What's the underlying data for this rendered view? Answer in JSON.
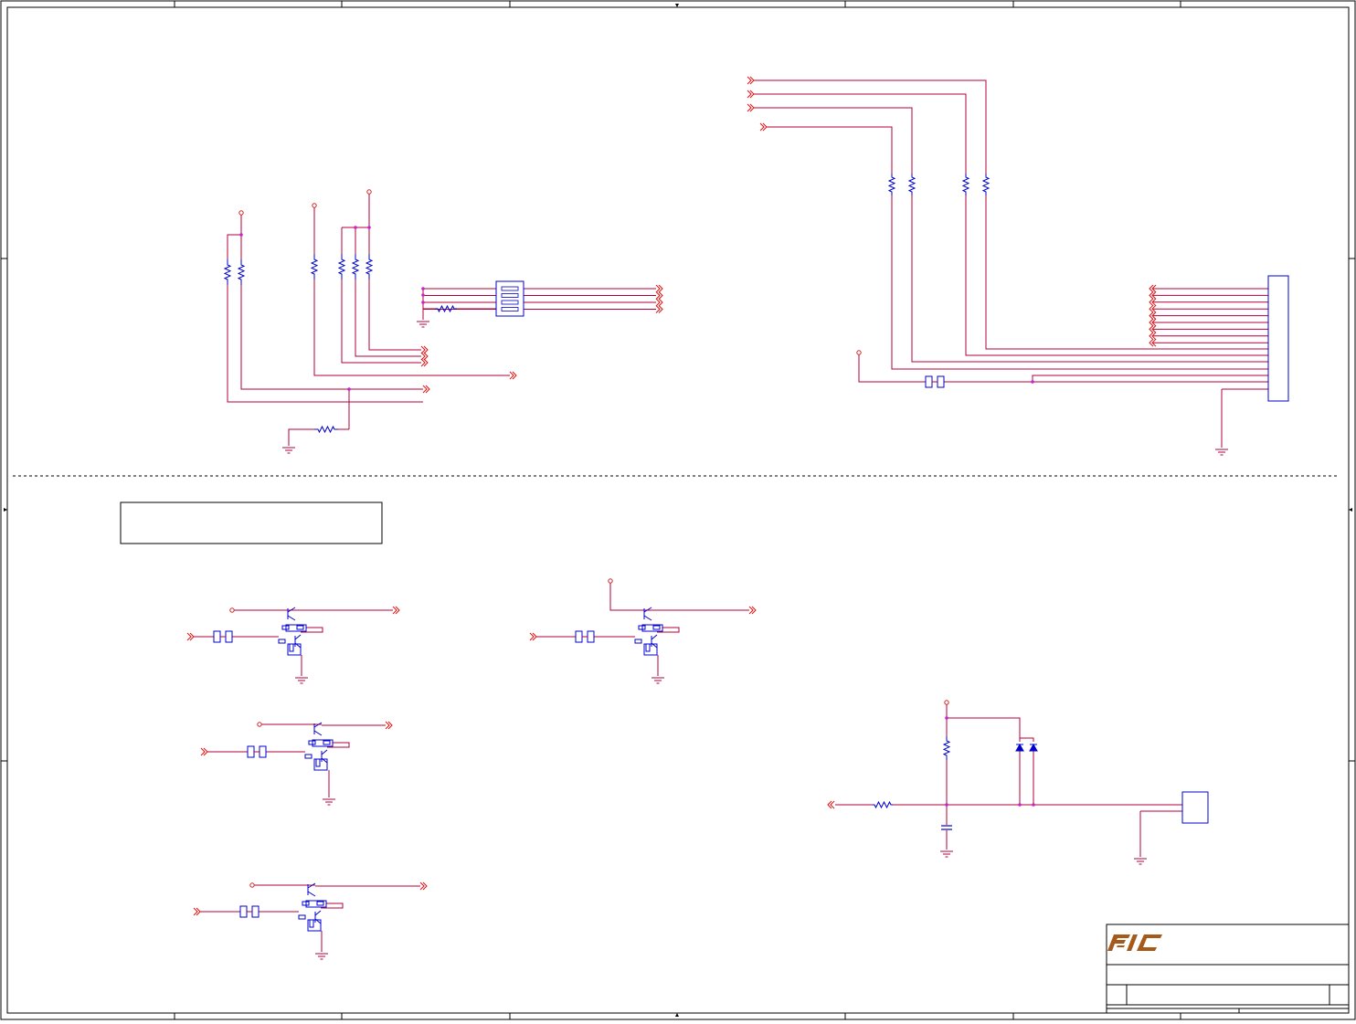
{
  "document": {
    "kind": "electronic-schematic",
    "colors": {
      "frame": "#000000",
      "wire": "#b0003a",
      "net_marker": "#dd1111",
      "component": "#0000cc",
      "junction": "#cc22cc",
      "power_pin": "#cc2222",
      "logo": "#a65a1a"
    }
  },
  "title_block": {
    "logo_icon": "fic-logo",
    "fields": []
  },
  "sections": {
    "top_left": "gpio-strap-resistor-network",
    "top_right": "connector-with-series-resistors",
    "bottom_left": "transistor-level-shifter-stages",
    "bottom_right": "diode-clamp-input"
  },
  "note_box": {
    "text": ""
  }
}
